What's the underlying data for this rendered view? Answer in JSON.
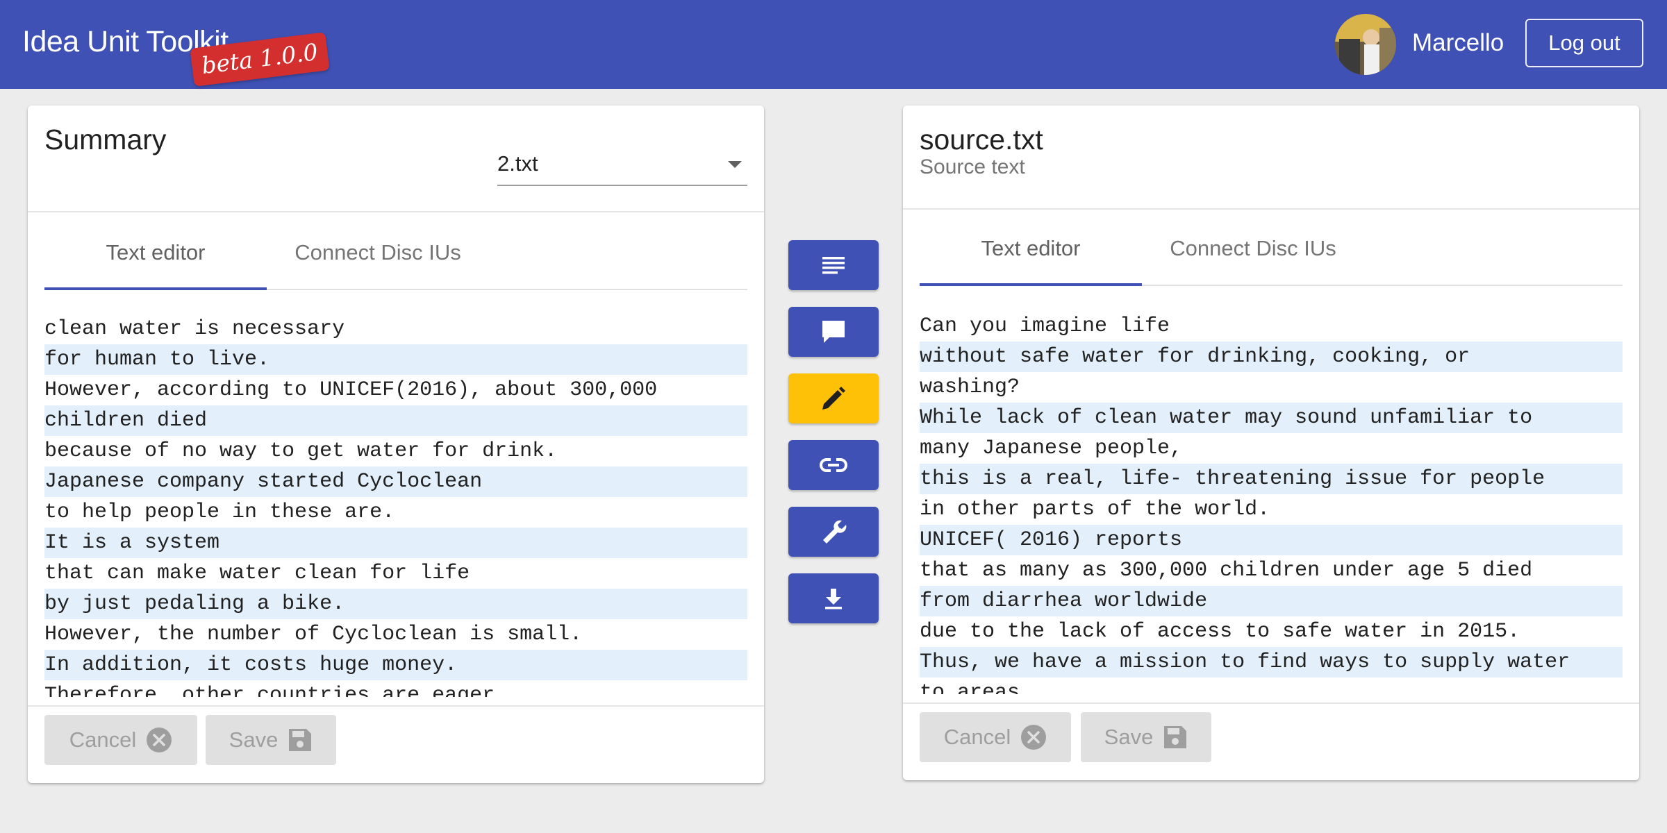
{
  "header": {
    "title": "Idea Unit Toolkit",
    "badge": "beta 1.0.0",
    "username": "Marcello",
    "logout_label": "Log out",
    "bar_color": "#3f51b5",
    "badge_color": "#d32f2f"
  },
  "left_panel": {
    "title": "Summary",
    "file_select": {
      "value": "2.txt"
    },
    "tabs": [
      {
        "label": "Text editor",
        "active": true
      },
      {
        "label": "Connect Disc IUs",
        "active": false
      }
    ],
    "lines": [
      "clean water is necessary",
      "for human to live.",
      "However, according to UNICEF(2016), about 300,000",
      "children died",
      "because of no way to get water for drink.",
      "Japanese company started Cycloclean",
      "to help people in these are.",
      "It is a system",
      "that can make water clean for life",
      "by just pedaling a bike.",
      "However, the number of Cycloclean is small.",
      "In addition, it costs huge money.",
      "Therefore, other countries are eager"
    ],
    "cancel_label": "Cancel",
    "save_label": "Save"
  },
  "right_panel": {
    "title": "source.txt",
    "subtitle": "Source text",
    "tabs": [
      {
        "label": "Text editor",
        "active": true
      },
      {
        "label": "Connect Disc IUs",
        "active": false
      }
    ],
    "lines": [
      "Can you imagine life",
      "without safe water for drinking, cooking, or",
      "washing?",
      "While lack of clean water may sound unfamiliar to",
      "many Japanese people,",
      "this is a real, life- threatening issue for people",
      "in other parts of the world.",
      "UNICEF( 2016) reports",
      "that as many as 300,000 children under age 5 died",
      "from diarrhea worldwide",
      "due to the lack of access to safe water in 2015.",
      "Thus, we have a mission to find ways to supply water",
      "to areas"
    ],
    "cancel_label": "Cancel",
    "save_label": "Save"
  },
  "toolbar": [
    {
      "icon": "text-lines-icon",
      "active": false
    },
    {
      "icon": "comment-icon",
      "active": false
    },
    {
      "icon": "pencil-icon",
      "active": true
    },
    {
      "icon": "link-icon",
      "active": false
    },
    {
      "icon": "wrench-icon",
      "active": false
    },
    {
      "icon": "download-icon",
      "active": false
    }
  ],
  "colors": {
    "primary": "#3f51b5",
    "tool_active": "#ffc107",
    "line_highlight": "#e3f0fb"
  }
}
